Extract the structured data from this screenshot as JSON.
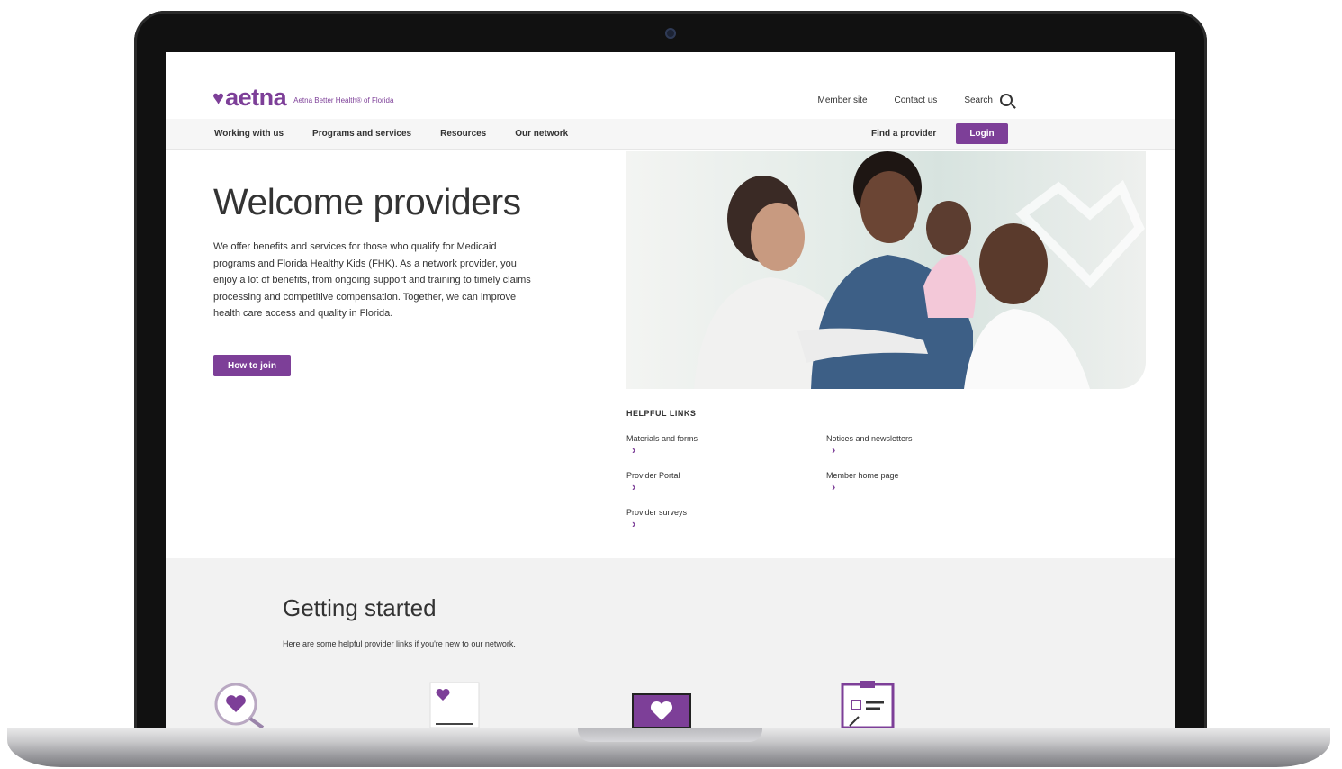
{
  "brand": {
    "heart": "♥",
    "wordmark": "aetna",
    "tagline": "Aetna Better Health® of Florida",
    "color": "#7d3f98"
  },
  "utility_nav": {
    "member_site": "Member site",
    "contact_us": "Contact us",
    "search": "Search"
  },
  "main_nav": {
    "items": [
      {
        "label": "Working with us"
      },
      {
        "label": "Programs and services"
      },
      {
        "label": "Resources"
      },
      {
        "label": "Our network"
      }
    ],
    "find_provider": "Find a provider",
    "login": "Login"
  },
  "hero": {
    "title": "Welcome providers",
    "body": "We offer benefits and services for those who qualify for Medicaid programs and Florida Healthy Kids (FHK). As a network provider, you enjoy a lot of benefits, from ongoing support and training to timely claims processing and competitive compensation. Together, we can improve health care access and quality in Florida.",
    "cta": "How to join"
  },
  "helpful_links": {
    "title": "HELPFUL LINKS",
    "items": [
      {
        "label": "Materials and forms"
      },
      {
        "label": "Notices and newsletters"
      },
      {
        "label": "Provider Portal"
      },
      {
        "label": "Member home page"
      },
      {
        "label": "Provider surveys"
      }
    ],
    "chevron": "›"
  },
  "getting_started": {
    "title": "Getting started",
    "subtitle": "Here are some helpful provider links if you're new to our network.",
    "icons": [
      "magnifier-heart-icon",
      "card-heart-icon",
      "laptop-heart-icon",
      "clipboard-icon"
    ]
  }
}
